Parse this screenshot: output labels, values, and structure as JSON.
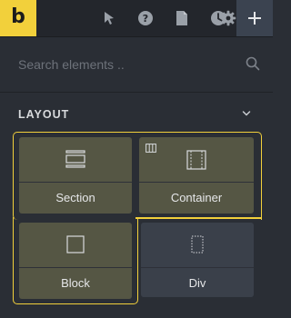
{
  "toolbar": {
    "logo_letter": "b",
    "buttons": [
      {
        "name": "select-pointer",
        "icon": "pointer-icon"
      },
      {
        "name": "help",
        "icon": "question-icon"
      },
      {
        "name": "page",
        "icon": "document-icon"
      },
      {
        "name": "history",
        "icon": "clock-icon"
      },
      {
        "name": "settings",
        "icon": "gear-icon"
      },
      {
        "name": "add",
        "icon": "plus-icon",
        "active": true
      }
    ]
  },
  "search": {
    "placeholder": "Search elements ..",
    "value": ""
  },
  "layout_section": {
    "title": "LAYOUT",
    "expanded": true,
    "elements": [
      {
        "label": "Section",
        "icon": "section-icon",
        "selected": true
      },
      {
        "label": "Container",
        "icon": "container-icon",
        "selected": true
      },
      {
        "label": "Block",
        "icon": "block-icon",
        "selected": true
      },
      {
        "label": "Div",
        "icon": "div-icon",
        "selected": false
      }
    ]
  },
  "colors": {
    "accent": "#f2d03b",
    "panel_bg": "#2a2e35",
    "toolbar_bg": "#23262c",
    "selected_card": "#555644",
    "card": "#3a404a"
  }
}
